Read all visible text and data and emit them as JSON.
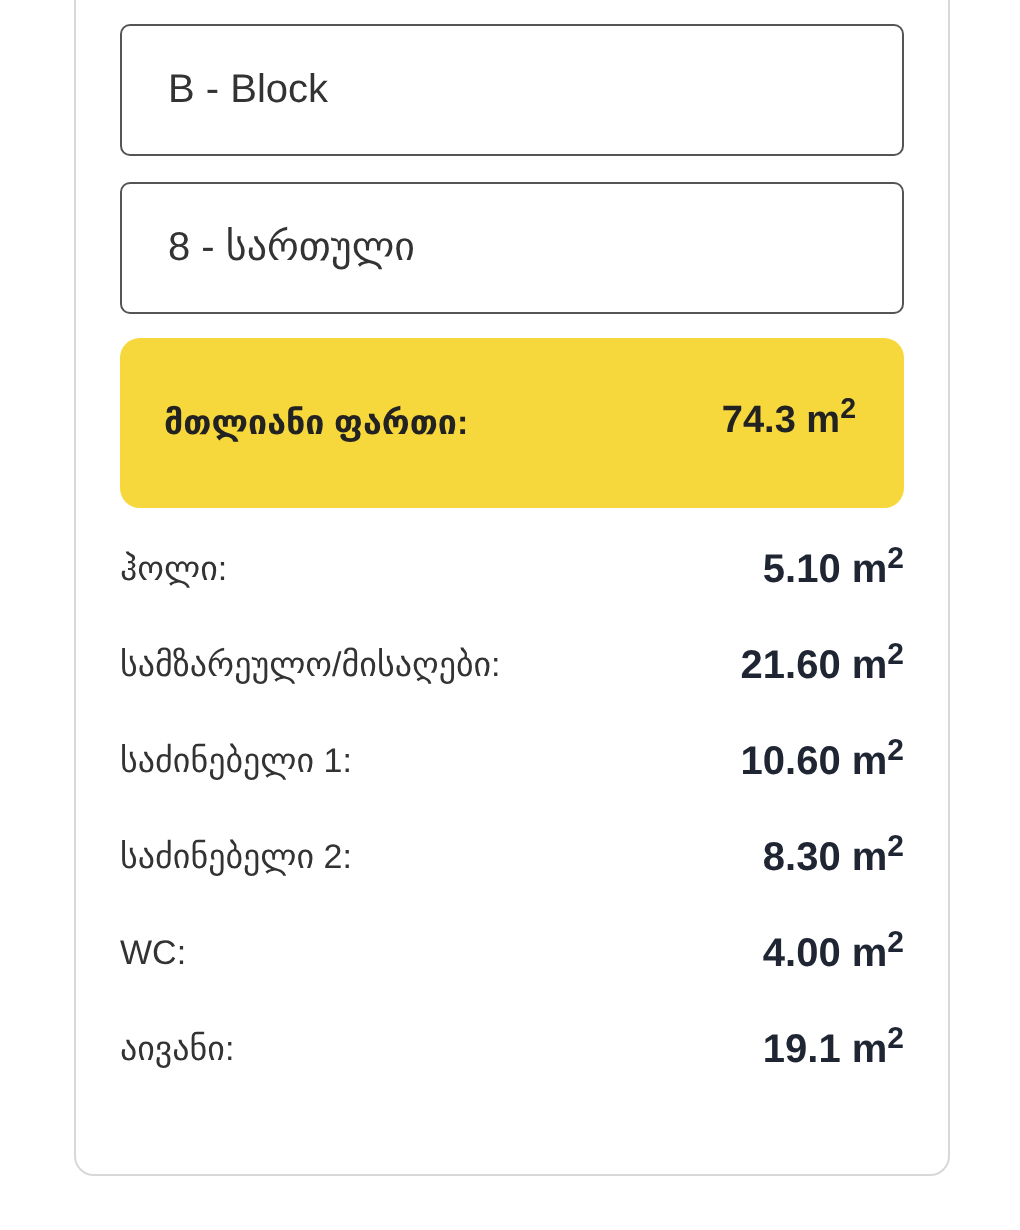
{
  "fields": [
    {
      "value": "B - Block"
    },
    {
      "value": "8 - სართული"
    }
  ],
  "total": {
    "label": "მთლიანი ფართი:",
    "value": "74.3 m$^{2}$"
  },
  "rooms": [
    {
      "label": "ჰოლი:",
      "value": "5.10 m$^{2}$"
    },
    {
      "label": "სამზარეულო/მისაღები:",
      "value": "21.60 m$^{2}$"
    },
    {
      "label": "საძინებელი 1:",
      "value": "10.60 m$^{2}$"
    },
    {
      "label": "საძინებელი 2:",
      "value": "8.30 m$^{2}$"
    },
    {
      "label": "WC:",
      "value": "4.00 m$^{2}$"
    },
    {
      "label": "აივანი:",
      "value": "19.1 m$^{2}$"
    }
  ]
}
